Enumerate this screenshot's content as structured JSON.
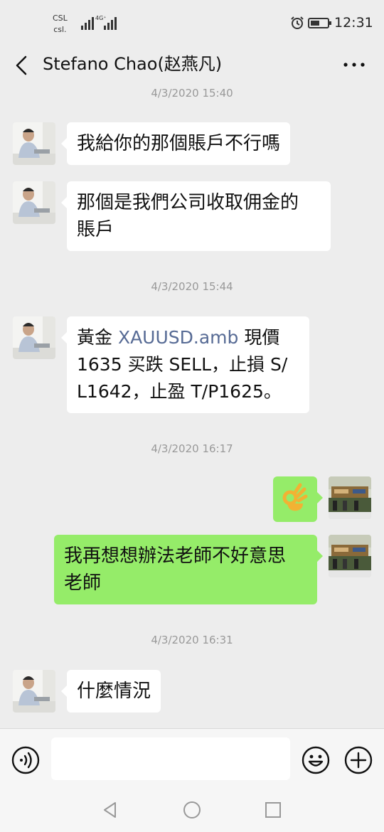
{
  "status_bar": {
    "carrier_line1": "CSL",
    "carrier_line2": "csl.",
    "network_type": "4G⁺",
    "time": "12:31"
  },
  "header": {
    "title": "Stefano Chao(赵燕凡)"
  },
  "timestamps": {
    "t1": "4/3/2020 15:40",
    "t2": "4/3/2020 15:44",
    "t3": "4/3/2020 16:17",
    "t4": "4/3/2020 16:31"
  },
  "messages": {
    "m1": "我給你的那個賬戶不行嗎",
    "m2_line1": "那個是我們公司收取佣金的",
    "m2_line2": "賬戶",
    "m3_prefix": "黃金 ",
    "m3_link": "XAUUSD.amb",
    "m3_suffix": " 現價",
    "m3_line2": "1635 买跌 SELL，止損 S/",
    "m3_line3": "L1642，止盈 T/P1625。",
    "m5_line1": "我再想想辦法老師不好意思",
    "m5_line2": "老師",
    "m6": "什麼情況"
  },
  "icons": {
    "emoji_sticker": "ok-hand-emoji",
    "voice": "voice-icon",
    "emoji": "emoji-icon",
    "plus": "plus-icon"
  },
  "colors": {
    "outgoing_bubble": "#95ec69",
    "incoming_bubble": "#ffffff",
    "link": "#576b95",
    "background": "#ededed"
  }
}
